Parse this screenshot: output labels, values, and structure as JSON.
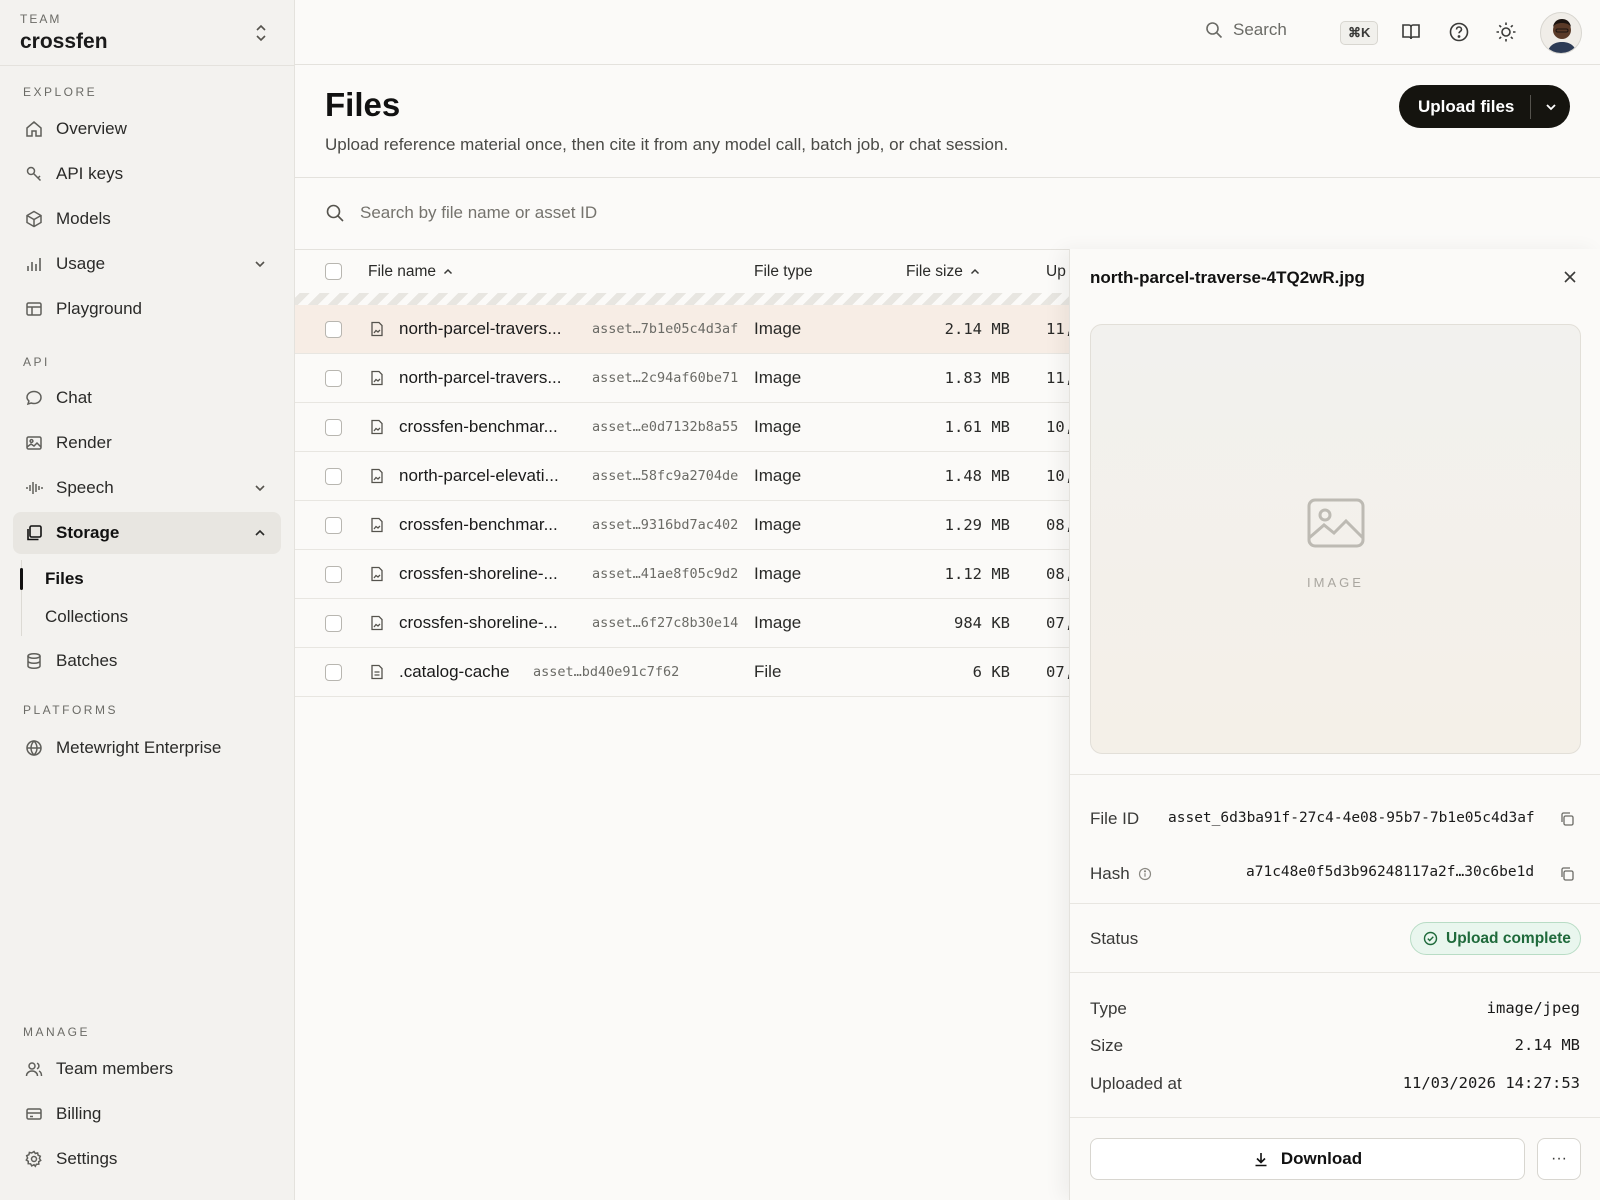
{
  "team": {
    "label": "TEAM",
    "name": "crossfen"
  },
  "sidebar": {
    "explore_label": "EXPLORE",
    "api_label": "API",
    "platforms_label": "PLATFORMS",
    "manage_label": "MANAGE",
    "items": {
      "overview": "Overview",
      "api_keys": "API keys",
      "models": "Models",
      "usage": "Usage",
      "playground": "Playground",
      "chat": "Chat",
      "render": "Render",
      "speech": "Speech",
      "storage": "Storage",
      "files": "Files",
      "collections": "Collections",
      "batches": "Batches",
      "enterprise": "Metewright Enterprise",
      "team_members": "Team members",
      "billing": "Billing",
      "settings": "Settings"
    }
  },
  "topbar": {
    "search_placeholder": "Search",
    "shortcut": "⌘K"
  },
  "header": {
    "title": "Files",
    "subtitle": "Upload reference material once, then cite it from any model call, batch job, or chat session.",
    "upload_label": "Upload files"
  },
  "search": {
    "placeholder": "Search by file name or asset ID"
  },
  "table": {
    "columns": {
      "name": "File name",
      "type": "File type",
      "size": "File size",
      "uploaded": "Up"
    },
    "rows": [
      {
        "name": "north-parcel-travers...",
        "asset": "asset…7b1e05c4d3af",
        "type": "Image",
        "size": "2.14 MB",
        "uploaded": "11,"
      },
      {
        "name": "north-parcel-travers...",
        "asset": "asset…2c94af60be71",
        "type": "Image",
        "size": "1.83 MB",
        "uploaded": "11,"
      },
      {
        "name": "crossfen-benchmar...",
        "asset": "asset…e0d7132b8a55",
        "type": "Image",
        "size": "1.61 MB",
        "uploaded": "10,"
      },
      {
        "name": "north-parcel-elevati...",
        "asset": "asset…58fc9a2704de",
        "type": "Image",
        "size": "1.48 MB",
        "uploaded": "10,"
      },
      {
        "name": "crossfen-benchmar...",
        "asset": "asset…9316bd7ac402",
        "type": "Image",
        "size": "1.29 MB",
        "uploaded": "08,"
      },
      {
        "name": "crossfen-shoreline-...",
        "asset": "asset…41ae8f05c9d2",
        "type": "Image",
        "size": "1.12 MB",
        "uploaded": "08,"
      },
      {
        "name": "crossfen-shoreline-...",
        "asset": "asset…6f27c8b30e14",
        "type": "Image",
        "size": "984 KB",
        "uploaded": "07,"
      },
      {
        "name": ".catalog-cache",
        "asset": "asset…bd40e91c7f62",
        "type": "File",
        "size": "6 KB",
        "uploaded": "07,"
      }
    ]
  },
  "drawer": {
    "title": "north-parcel-traverse-4TQ2wR.jpg",
    "preview_label": "IMAGE",
    "file_id_label": "File ID",
    "file_id": "asset_6d3ba91f-27c4-4e08-95b7-7b1e05c4d3af",
    "hash_label": "Hash",
    "hash": "a71c48e0f5d3b96248117a2f…30c6be1d",
    "status_label": "Status",
    "status": "Upload complete",
    "type_label": "Type",
    "type": "image/jpeg",
    "size_label": "Size",
    "size": "2.14 MB",
    "uploaded_label": "Uploaded at",
    "uploaded": "11/03/2026 14:27:53",
    "download_label": "Download",
    "more_label": "···"
  },
  "colors": {
    "primary_button": "#15140f",
    "status_green": "#1f6a3b",
    "selected_row": "#f7ede5"
  }
}
